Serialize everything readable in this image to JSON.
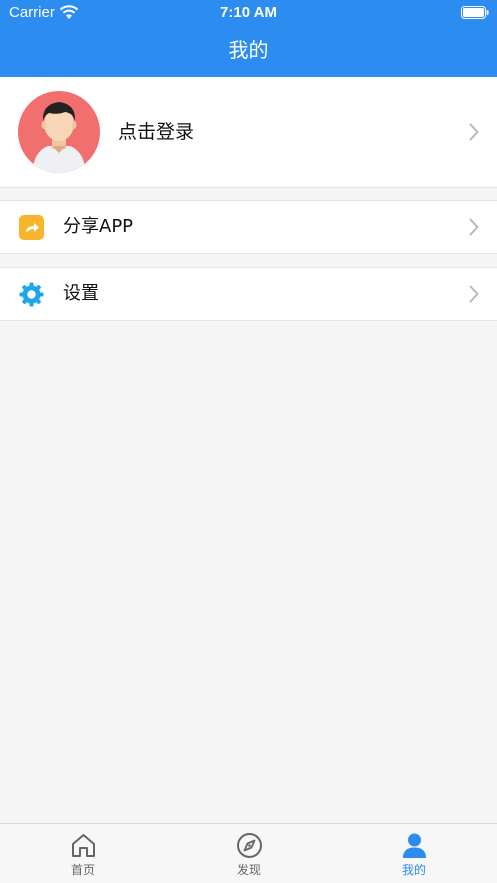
{
  "status_bar": {
    "carrier": "Carrier",
    "time": "7:10 AM"
  },
  "nav": {
    "title": "我的"
  },
  "profile": {
    "login_label": "点击登录"
  },
  "menu": [
    {
      "label": "分享APP",
      "icon": "share-icon",
      "icon_color": "#f7b52c"
    },
    {
      "label": "设置",
      "icon": "gear-icon",
      "icon_color": "#1aa7ec"
    }
  ],
  "tab_bar": {
    "tabs": [
      {
        "label": "首页",
        "icon": "home-icon",
        "active": false
      },
      {
        "label": "发现",
        "icon": "compass-icon",
        "active": false
      },
      {
        "label": "我的",
        "icon": "person-icon",
        "active": true
      }
    ]
  },
  "colors": {
    "primary": "#2d8cf0",
    "background": "#f5f5f5",
    "avatar_bg": "#f26f6f"
  }
}
